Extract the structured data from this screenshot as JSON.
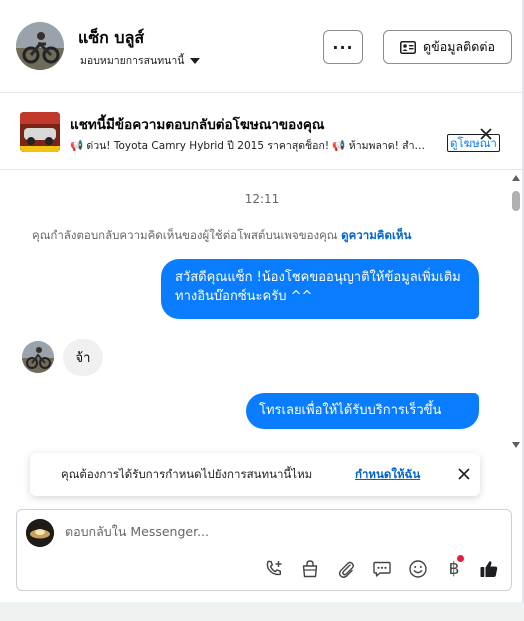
{
  "header": {
    "contact_name": "แซ็ก บลูส์",
    "assign_label": "มอบหมายการสนทนานี้",
    "more_label": "···",
    "contact_info_label": "ดูข้อมูลติดต่อ"
  },
  "ad_banner": {
    "title": "แชทนี้มีข้อความตอบกลับต่อโฆษณาของคุณ",
    "subtitle": "📢 ด่วน! Toyota Camry Hybrid ปี 2015 ราคาสุดช็อก! 📢 ห้ามพลาด! สำ…",
    "view_ad_label": "ดูโฆษณา"
  },
  "chat": {
    "timestamp": "12:11",
    "comment_note": "คุณกำลังตอบกลับความคิดเห็นของผู้ใช้ต่อโพสต์บนเพจของคุณ",
    "view_comment_label": "ดูความคิดเห็น",
    "messages": [
      {
        "direction": "out",
        "text": "สวัสดีคุณแซ็ก !น้องโชคขออนุญาติให้ข้อมูลเพิ่มเติมทางอินบ๊อกซ์นะครับ ^^"
      },
      {
        "direction": "in",
        "text": "จ้า"
      },
      {
        "direction": "out",
        "text": "โทรเลยเพื่อให้ได้รับบริการเร็วขึ้น"
      }
    ]
  },
  "reminder": {
    "text": "คุณต้องการได้รับการกำหนดไปยังการสนทนานี้ไหม",
    "action_label": "กำหนดให้ฉัน"
  },
  "composer": {
    "placeholder": "ตอบกลับใน Messenger...",
    "tools": [
      "phone-plus-icon",
      "shopping-bag-icon",
      "paperclip-icon",
      "chat-bubble-icon",
      "emoji-icon",
      "baht-icon",
      "thumbs-up-icon"
    ],
    "baht_symbol": "฿"
  },
  "colors": {
    "accent": "#0a7cff",
    "link": "#0064d1",
    "notification_dot": "#e41e3f"
  }
}
